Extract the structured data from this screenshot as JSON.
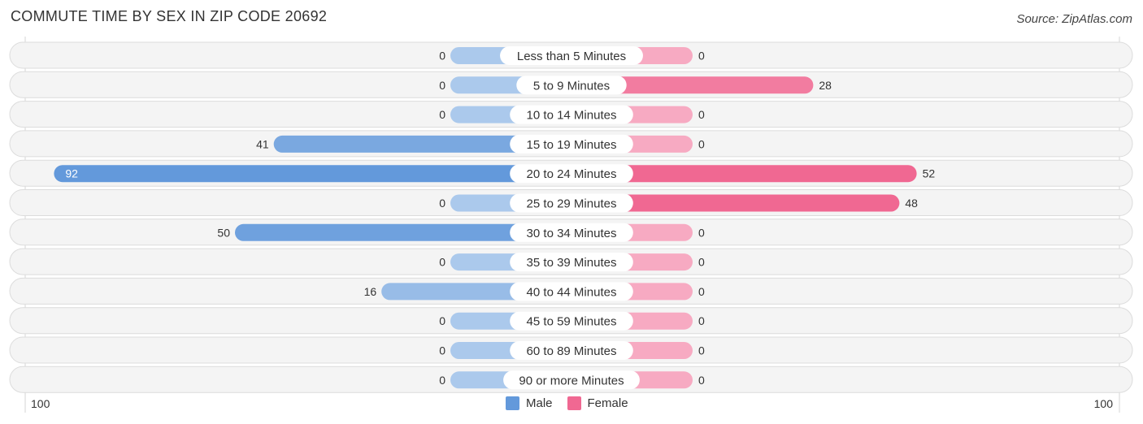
{
  "chart_data": {
    "type": "bar",
    "orientation": "horizontal-diverging",
    "title": "COMMUTE TIME BY SEX IN ZIP CODE 20692",
    "source": "Source: ZipAtlas.com",
    "categories": [
      "Less than 5 Minutes",
      "5 to 9 Minutes",
      "10 to 14 Minutes",
      "15 to 19 Minutes",
      "20 to 24 Minutes",
      "25 to 29 Minutes",
      "30 to 34 Minutes",
      "35 to 39 Minutes",
      "40 to 44 Minutes",
      "45 to 59 Minutes",
      "60 to 89 Minutes",
      "90 or more Minutes"
    ],
    "series": [
      {
        "name": "Male",
        "color": "#6399db",
        "color_light": "#abc9ec",
        "values": [
          0,
          0,
          0,
          41,
          92,
          0,
          50,
          0,
          16,
          0,
          0,
          0
        ]
      },
      {
        "name": "Female",
        "color": "#f06892",
        "color_light": "#f7aac2",
        "values": [
          0,
          28,
          0,
          0,
          52,
          48,
          0,
          0,
          0,
          0,
          0,
          0
        ]
      }
    ],
    "axis": {
      "left_label": "100",
      "right_label": "100",
      "range": [
        0,
        100
      ]
    },
    "legend": {
      "position": "bottom-center",
      "items": [
        {
          "label": "Male",
          "color": "#6399db"
        },
        {
          "label": "Female",
          "color": "#f06892"
        }
      ]
    }
  }
}
